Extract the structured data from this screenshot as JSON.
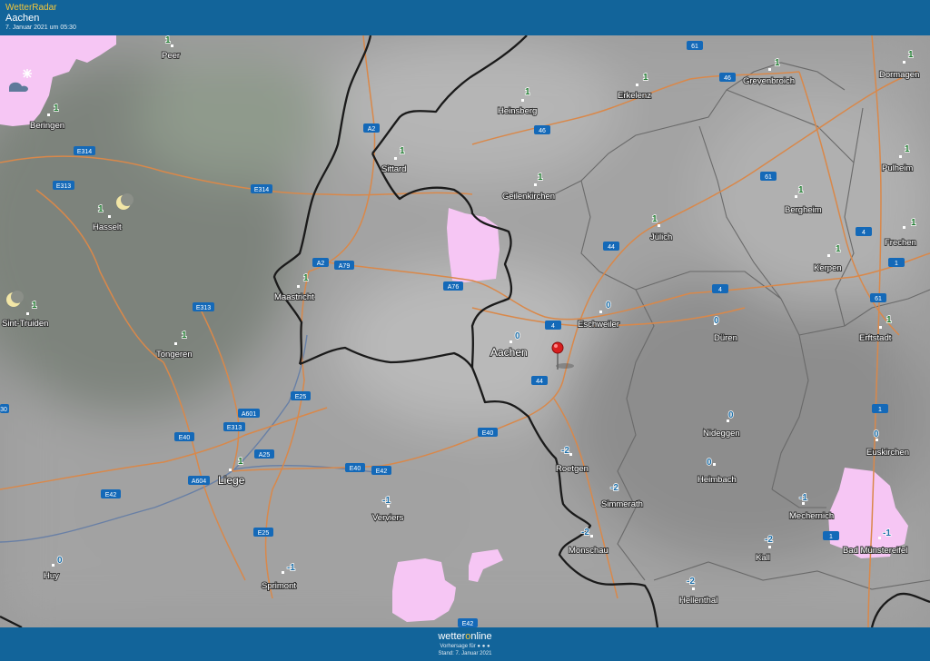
{
  "header": {
    "app": "WetterRadar",
    "location": "Aachen",
    "date": "7. Januar 2021 um 05:30"
  },
  "footer": {
    "brand_pre": "wetter",
    "brand_o": "o",
    "brand_post": "nline",
    "valid": "Vorhersage für ● ● ●",
    "stand": "Stand: 7. Januar 2021"
  },
  "colors": {
    "bar": "#12649a",
    "precip": "#f6c6f4",
    "road": "#d9884a",
    "border": "#1a1a1a",
    "temp_green": "#1f7a2f",
    "temp_blue": "#1d6fa8"
  },
  "icons": {
    "marker": "map-pin-icon",
    "moon": "moon-icon",
    "snow": "snowflake-icon"
  },
  "cities": [
    {
      "id": "peer",
      "name": "Peer",
      "temp": "1"
    },
    {
      "id": "beringen",
      "name": "Beringen",
      "temp": "1"
    },
    {
      "id": "hasselt",
      "name": "Hasselt",
      "temp": "1"
    },
    {
      "id": "sint-truiden",
      "name": "Sint-Truiden",
      "temp": "1"
    },
    {
      "id": "tongeren",
      "name": "Tongeren",
      "temp": "1"
    },
    {
      "id": "maastricht",
      "name": "Maastricht",
      "temp": "1"
    },
    {
      "id": "sittard",
      "name": "Sittard",
      "temp": "1"
    },
    {
      "id": "heinsberg",
      "name": "Heinsberg",
      "temp": "1"
    },
    {
      "id": "geilenkirchen",
      "name": "Geilenkirchen",
      "temp": "1"
    },
    {
      "id": "erkelenz",
      "name": "Erkelenz",
      "temp": "1"
    },
    {
      "id": "grevenbroich",
      "name": "Grevenbroich",
      "temp": "1"
    },
    {
      "id": "dormagen",
      "name": "Dormagen",
      "temp": "1"
    },
    {
      "id": "pulheim",
      "name": "Pulheim",
      "temp": "1"
    },
    {
      "id": "bergheim",
      "name": "Bergheim",
      "temp": "1"
    },
    {
      "id": "juelich",
      "name": "Jülich",
      "temp": "1"
    },
    {
      "id": "frechen",
      "name": "Frechen",
      "temp": "1"
    },
    {
      "id": "kerpen",
      "name": "Kerpen",
      "temp": "1"
    },
    {
      "id": "erftstadt",
      "name": "Erftstadt",
      "temp": "1"
    },
    {
      "id": "eschweiler",
      "name": "Eschweiler",
      "temp": "0"
    },
    {
      "id": "aachen",
      "name": "Aachen",
      "temp": "0"
    },
    {
      "id": "dueren",
      "name": "Düren",
      "temp": "0"
    },
    {
      "id": "nideggen",
      "name": "Nideggen",
      "temp": "0"
    },
    {
      "id": "euskirchen",
      "name": "Euskirchen",
      "temp": "0"
    },
    {
      "id": "liege",
      "name": "Liege",
      "temp": "1"
    },
    {
      "id": "huy",
      "name": "Huy",
      "temp": "0"
    },
    {
      "id": "verviers",
      "name": "Verviers",
      "temp": "-1"
    },
    {
      "id": "sprimont",
      "name": "Sprimont",
      "temp": "-1"
    },
    {
      "id": "roetgen",
      "name": "Roetgen",
      "temp": "-2"
    },
    {
      "id": "simmerath",
      "name": "Simmerath",
      "temp": "-2"
    },
    {
      "id": "monschau",
      "name": "Monschau",
      "temp": "-2"
    },
    {
      "id": "heimbach",
      "name": "Heimbach",
      "temp": "0"
    },
    {
      "id": "mechernich",
      "name": "Mechernich",
      "temp": "-1"
    },
    {
      "id": "kall",
      "name": "Kall",
      "temp": "-2"
    },
    {
      "id": "hellenthal",
      "name": "Hellenthal",
      "temp": "-2"
    },
    {
      "id": "bad-muenstereifel",
      "name": "Bad Münstereifel",
      "temp": "-1"
    }
  ],
  "roads": {
    "e314a": "E314",
    "e313a": "E313",
    "e314b": "E314",
    "a2a": "A2",
    "a2b": "A2",
    "a79": "A79",
    "a76": "A76",
    "e313b": "E313",
    "e25a": "E25",
    "a601": "A601",
    "e313c": "E313",
    "e40a": "E40",
    "a25": "A25",
    "a604": "A604",
    "e42a": "E42",
    "e40b": "E40",
    "e42b": "E42",
    "e25b": "E25",
    "e40c": "E40",
    "a44a": "44",
    "a4a": "4",
    "a44b": "44",
    "a4b": "4",
    "a46": "46",
    "a46b": "46",
    "a61a": "61",
    "a61b": "61",
    "a4c": "4",
    "a1a": "1",
    "a61c": "61",
    "a1b": "1",
    "a1c": "1",
    "e42c": "E42",
    "e30": "30"
  }
}
